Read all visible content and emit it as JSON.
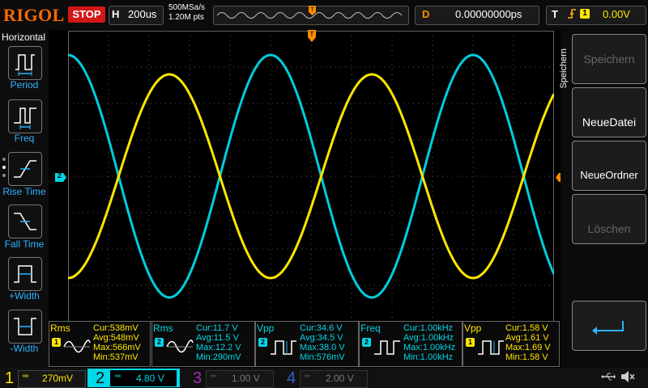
{
  "header": {
    "brand": "RIGOL",
    "run_state": "STOP",
    "timebase_letter": "H",
    "timebase_value": "200us",
    "sample_rate": "500MSa/s",
    "memory_depth": "1.20M pts",
    "delay_letter": "D",
    "delay_value": "0.00000000ps",
    "trigger_letter": "T",
    "trigger_source": "1",
    "trigger_level": "0.00V"
  },
  "left_menu": {
    "title": "Horizontal",
    "items": [
      {
        "label": "Period"
      },
      {
        "label": "Freq"
      },
      {
        "label": "Rise Time"
      },
      {
        "label": "Fall Time"
      },
      {
        "label": "+Width"
      },
      {
        "label": "-Width"
      }
    ]
  },
  "right_menu": {
    "title": "Speichern",
    "items": [
      {
        "label": "Speichern"
      },
      {
        "label": "NeueDatei"
      },
      {
        "label": "NeueOrdner"
      },
      {
        "label": "Löschen"
      }
    ]
  },
  "markers": {
    "ch2_marker": "2"
  },
  "measurements": [
    {
      "name": "Rms",
      "channel": "1",
      "color": "#ffe600",
      "cur": "Cur:538mV",
      "avg": "Avg:548mV",
      "max": "Max:566mV",
      "min": "Min:537mV"
    },
    {
      "name": "Rms",
      "channel": "2",
      "color": "#00d8e8",
      "cur": "Cur:11.7 V",
      "avg": "Avg:11.5 V",
      "max": "Max:12.2 V",
      "min": "Min:290mV"
    },
    {
      "name": "Vpp",
      "channel": "2",
      "color": "#00d8e8",
      "cur": "Cur:34.6 V",
      "avg": "Avg:34.5 V",
      "max": "Max:38.0 V",
      "min": "Min:576mV"
    },
    {
      "name": "Freq",
      "channel": "2",
      "color": "#00d8e8",
      "cur": "Cur:1.00kHz",
      "avg": "Avg:1.00kHz",
      "max": "Max:1.00kHz",
      "min": "Min:1.00kHz"
    },
    {
      "name": "Vpp",
      "channel": "1",
      "color": "#ffe600",
      "cur": "Cur:1.58 V",
      "avg": "Avg:1.61 V",
      "max": "Max:1.69 V",
      "min": "Min:1.58 V"
    }
  ],
  "channels": [
    {
      "num": "1",
      "scale": "270mV",
      "color": "#ffe600",
      "active": true
    },
    {
      "num": "2",
      "scale": "4.80 V",
      "color": "#00d8e8",
      "active": true
    },
    {
      "num": "3",
      "scale": "1.00 V",
      "color": "#a030b0",
      "active": false
    },
    {
      "num": "4",
      "scale": "2.00 V",
      "color": "#3060d0",
      "active": false
    }
  ],
  "colors": {
    "ch1": "#ffe600",
    "ch2": "#00d8e8",
    "trigger": "#ff8c00",
    "menu_label": "#2db3ff",
    "stop": "#d41616"
  },
  "waveforms": {
    "frequency_khz": 1.0,
    "ch1_phase_deg": 180,
    "ch2_phase_deg": 0
  },
  "icons": {
    "usb": "usb-icon",
    "sound": "speaker-muted-icon",
    "return": "return-arrow-icon"
  }
}
